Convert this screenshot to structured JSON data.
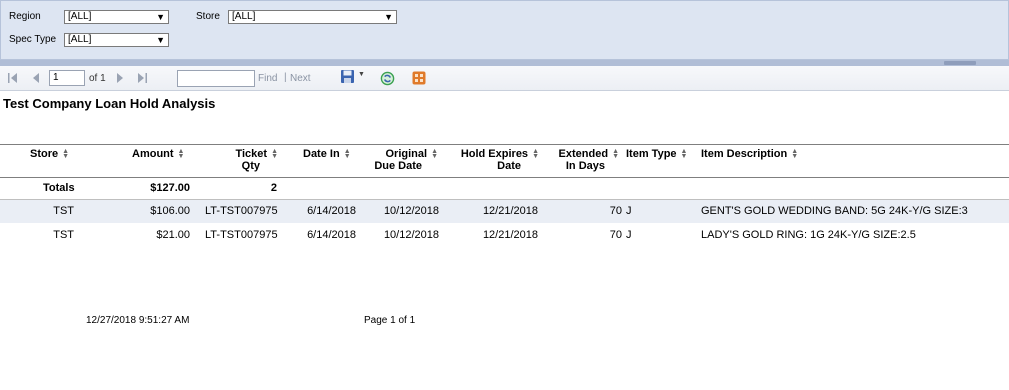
{
  "params": {
    "region_label": "Region",
    "region_value": "[ALL]",
    "store_label": "Store",
    "store_value": "[ALL]",
    "spec_type_label": "Spec Type",
    "spec_type_value": "[ALL]"
  },
  "toolbar": {
    "page_value": "1",
    "of_pages": "of 1",
    "find_label": "Find",
    "separator": "|",
    "next_label": "Next"
  },
  "report": {
    "title": "Test Company Loan Hold Analysis",
    "headers": {
      "store": "Store",
      "amount": "Amount",
      "ticket_qty_1": "Ticket",
      "ticket_qty_2": "Qty",
      "date_in": "Date In",
      "orig_due_1": "Original",
      "orig_due_2": "Due Date",
      "hold_exp_1": "Hold Expires",
      "hold_exp_2": "Date",
      "ext_days_1": "Extended",
      "ext_days_2": "In Days",
      "item_type": "Item Type",
      "item_desc": "Item Description"
    },
    "totals": {
      "label": "Totals",
      "amount": "$127.00",
      "ticket_qty": "2"
    },
    "rows": [
      {
        "store": "TST",
        "amount": "$106.00",
        "ticket": "LT-TST007975",
        "date_in": "6/14/2018",
        "orig_due": "10/12/2018",
        "hold_expires": "12/21/2018",
        "extended_days": "70",
        "item_type": "J",
        "item_desc": "GENT'S GOLD WEDDING BAND: 5G 24K-Y/G SIZE:3"
      },
      {
        "store": "TST",
        "amount": "$21.00",
        "ticket": "LT-TST007975",
        "date_in": "6/14/2018",
        "orig_due": "10/12/2018",
        "hold_expires": "12/21/2018",
        "extended_days": "70",
        "item_type": "J",
        "item_desc": "LADY'S GOLD RING: 1G 24K-Y/G SIZE:2.5"
      }
    ],
    "footer_timestamp": "12/27/2018 9:51:27 AM",
    "footer_page": "Page 1 of 1"
  },
  "colors": {
    "param_bg": "#dde5f2",
    "splitter": "#b0bdd6",
    "row_shade": "#eaeef5",
    "export_icon": "#3a64b0",
    "refresh_icon": "#3aa050",
    "doc_map_icon": "#e07a2a"
  },
  "icons": [
    "first-page-icon",
    "prev-page-icon",
    "next-page-icon",
    "last-page-icon",
    "export-save-icon",
    "dropdown-arrow-icon",
    "refresh-icon",
    "document-map-icon",
    "sort-icon"
  ]
}
